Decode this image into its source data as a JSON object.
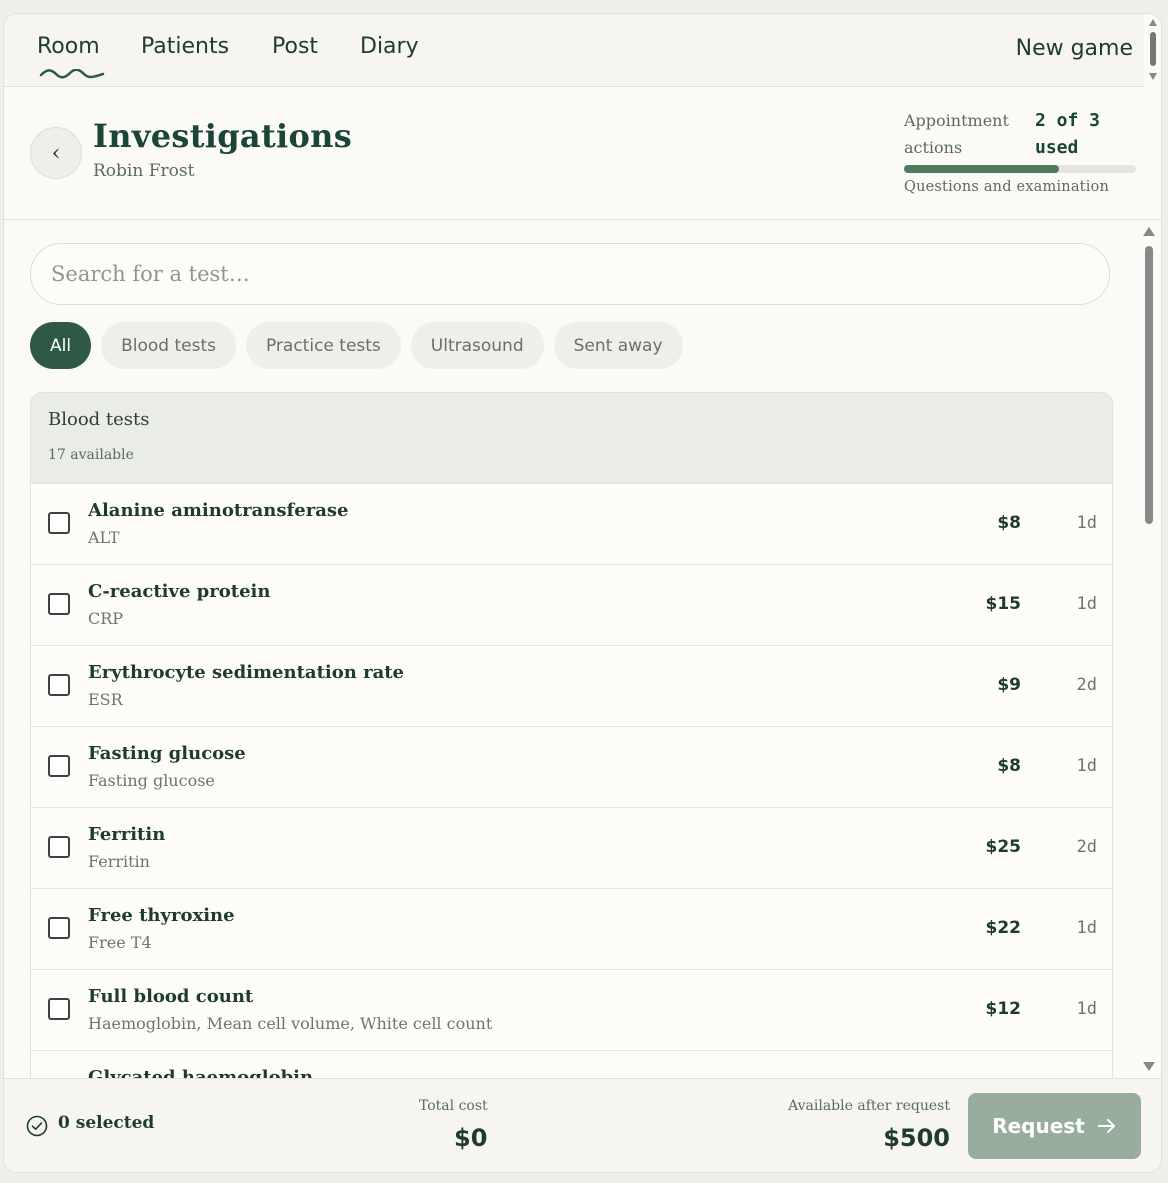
{
  "nav": {
    "tabs": [
      {
        "label": "Room"
      },
      {
        "label": "Patients"
      },
      {
        "label": "Post"
      },
      {
        "label": "Diary"
      }
    ],
    "active_tab": "Room",
    "new_game": "New game"
  },
  "header": {
    "back_icon": "chevron-left-icon",
    "title": "Investigations",
    "patient": "Robin Frost",
    "actions_label": "Appointment actions",
    "actions_count": "2 of 3 used",
    "actions_used": 2,
    "actions_total": 3,
    "progress_caption": "Questions and examination"
  },
  "search": {
    "placeholder": "Search for a test…",
    "value": ""
  },
  "filters": [
    {
      "label": "All",
      "active": true
    },
    {
      "label": "Blood tests",
      "active": false
    },
    {
      "label": "Practice tests",
      "active": false
    },
    {
      "label": "Ultrasound",
      "active": false
    },
    {
      "label": "Sent away",
      "active": false
    }
  ],
  "group": {
    "title": "Blood tests",
    "count": "17 available",
    "tests": [
      {
        "name": "Alanine aminotransferase",
        "sub": "ALT",
        "cost": "$8",
        "time": "1d",
        "checked": false
      },
      {
        "name": "C-reactive protein",
        "sub": "CRP",
        "cost": "$15",
        "time": "1d",
        "checked": false
      },
      {
        "name": "Erythrocyte sedimentation rate",
        "sub": "ESR",
        "cost": "$9",
        "time": "2d",
        "checked": false
      },
      {
        "name": "Fasting glucose",
        "sub": "Fasting glucose",
        "cost": "$8",
        "time": "1d",
        "checked": false
      },
      {
        "name": "Ferritin",
        "sub": "Ferritin",
        "cost": "$25",
        "time": "2d",
        "checked": false
      },
      {
        "name": "Free thyroxine",
        "sub": "Free T4",
        "cost": "$22",
        "time": "1d",
        "checked": false
      },
      {
        "name": "Full blood count",
        "sub": "Haemoglobin, Mean cell volume, White cell count",
        "cost": "$12",
        "time": "1d",
        "checked": false
      },
      {
        "name": "Glycated haemoglobin",
        "sub": "",
        "cost": "",
        "time": "",
        "checked": false
      }
    ]
  },
  "footer": {
    "selected": "0 selected",
    "total_label": "Total cost",
    "total_value": "$0",
    "avail_label": "Available after request",
    "avail_value": "$500",
    "request_label": "Request"
  },
  "colors": {
    "brand": "#2e5a45",
    "accent": "#4e7a5e",
    "button_disabled": "#98ad9d",
    "background": "#fbfaf6"
  }
}
